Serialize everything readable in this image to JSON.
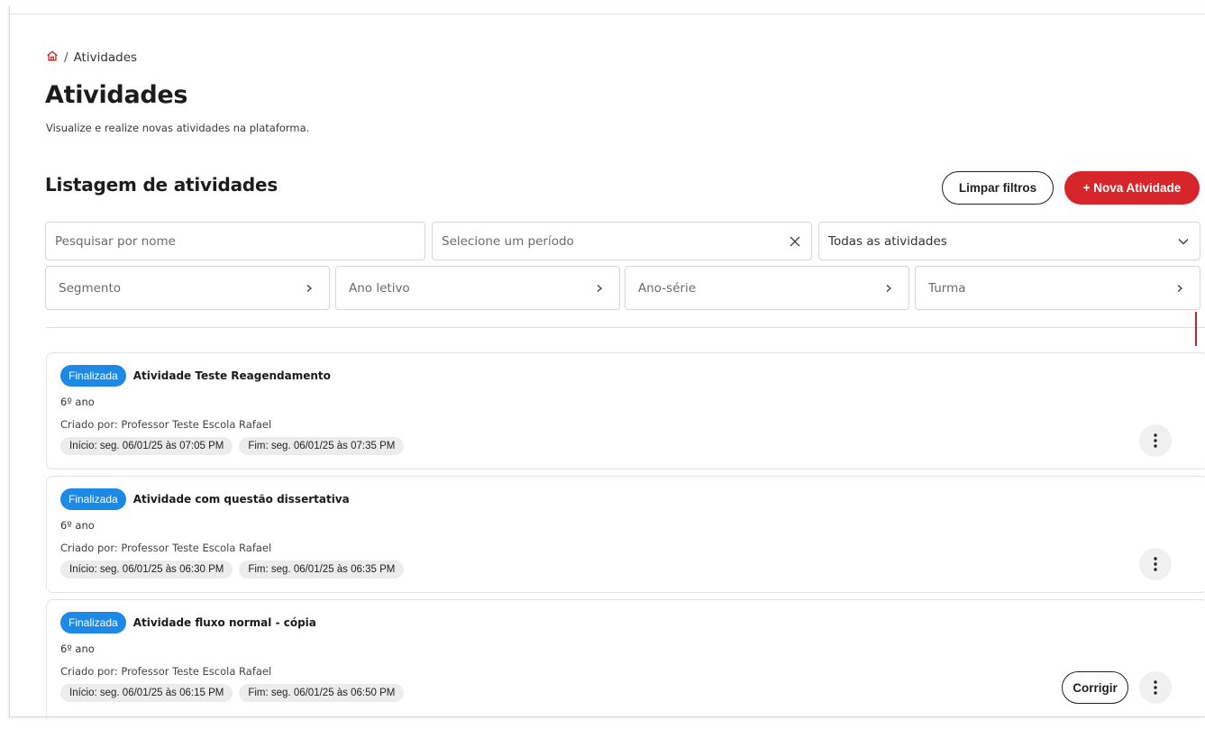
{
  "breadcrumb": {
    "icon": "home-icon",
    "separator": "/",
    "current": "Atividades"
  },
  "page": {
    "title": "Atividades",
    "subtitle": "Visualize e realize novas atividades na plataforma."
  },
  "list": {
    "title": "Listagem de atividades",
    "clear_filters_label": "Limpar filtros",
    "new_activity_label": "+ Nova Atividade"
  },
  "filters": {
    "search_placeholder": "Pesquisar por nome",
    "period_placeholder": "Selecione um período",
    "type_value": "Todas as atividades",
    "segment": "Segmento",
    "school_year": "Ano letivo",
    "grade": "Ano-série",
    "class": "Turma"
  },
  "colors": {
    "accent": "#d7262b",
    "badge": "#1e88e5"
  },
  "activities": [
    {
      "status": "Finalizada",
      "title": "Atividade Teste Reagendamento",
      "grade": "6º ano",
      "creator": "Criado por: Professor Teste Escola Rafael",
      "start": "Início: seg. 06/01/25 às 07:05 PM",
      "end": "Fim: seg. 06/01/25 às 07:35 PM"
    },
    {
      "status": "Finalizada",
      "title": "Atividade com questão dissertativa",
      "grade": "6º ano",
      "creator": "Criado por: Professor Teste Escola Rafael",
      "start": "Início: seg. 06/01/25 às 06:30 PM",
      "end": "Fim: seg. 06/01/25 às 06:35 PM"
    },
    {
      "status": "Finalizada",
      "title": "Atividade fluxo normal - cópia",
      "grade": "6º ano",
      "creator": "Criado por: Professor Teste Escola Rafael",
      "start": "Início: seg. 06/01/25 às 06:15 PM",
      "end": "Fim: seg. 06/01/25 às 06:50 PM",
      "action_label": "Corrigir"
    }
  ]
}
